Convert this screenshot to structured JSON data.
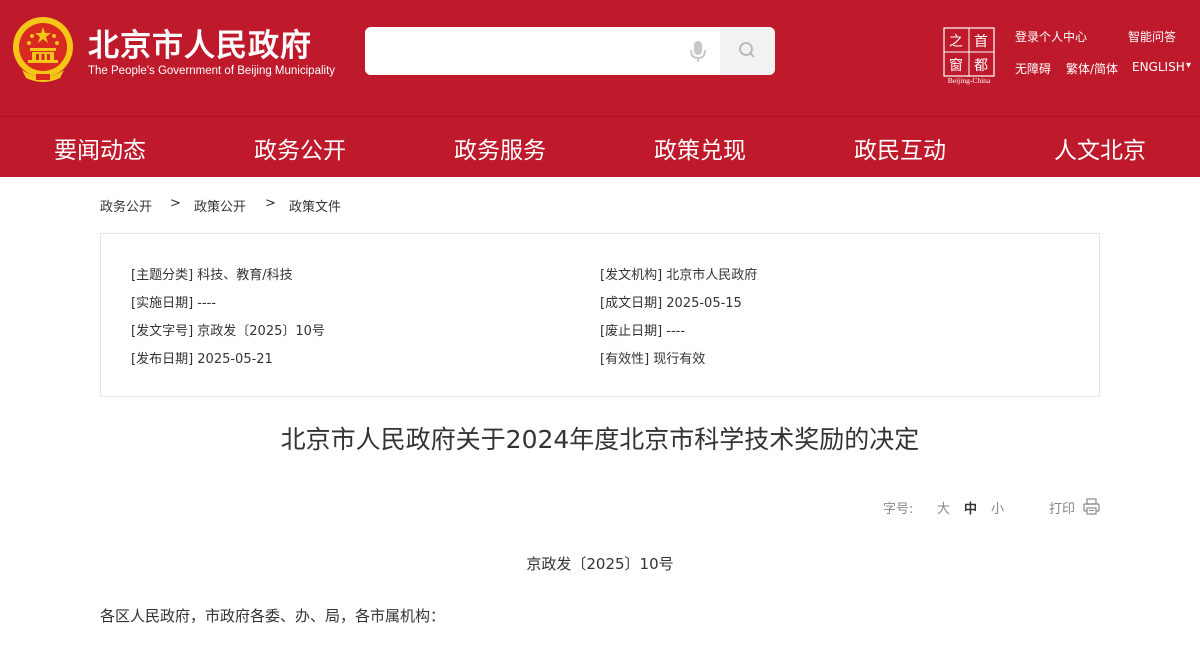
{
  "header": {
    "title": "北京市人民政府",
    "subtitle": "The People's Government of Beijing Municipality",
    "search_placeholder": "",
    "bj_window_chars": [
      "之",
      "首",
      "窗",
      "都"
    ],
    "bj_window_caption": "Beijing-China",
    "links": {
      "login": "登录个人中心",
      "qa": "智能问答",
      "accessibility": "无障碍",
      "traditional_simplified": "繁体/简体",
      "english": "ENGLISH",
      "english_arrow": "▾"
    }
  },
  "nav": [
    "要闻动态",
    "政务公开",
    "政务服务",
    "政策兑现",
    "政民互动",
    "人文北京"
  ],
  "breadcrumb": {
    "items": [
      "政务公开",
      "政策公开",
      "政策文件"
    ],
    "separator": ">"
  },
  "info": {
    "topic": "[主题分类] 科技、教育/科技",
    "issuer": "[发文机构] 北京市人民政府",
    "effective_date": "[实施日期] ----",
    "written_date": "[成文日期] 2025-05-15",
    "doc_no": "[发文字号] 京政发〔2025〕10号",
    "abolish_date": "[废止日期] ----",
    "publish_date": "[发布日期] 2025-05-21",
    "validity": "[有效性] 现行有效"
  },
  "document": {
    "title": "北京市人民政府关于2024年度北京市科学技术奖励的决定",
    "number": "京政发〔2025〕10号",
    "salutation": "各区人民政府，市政府各委、办、局，各市属机构："
  },
  "tools": {
    "font_size_label": "字号:",
    "large": "大",
    "medium": "中",
    "small": "小",
    "print": "打印"
  },
  "colors": {
    "brand_red": "#be1a2c",
    "emblem_gold": "#f5c518"
  },
  "icons": {
    "emblem": "national-emblem-icon",
    "mic": "microphone-icon",
    "search": "search-icon",
    "print": "printer-icon"
  }
}
